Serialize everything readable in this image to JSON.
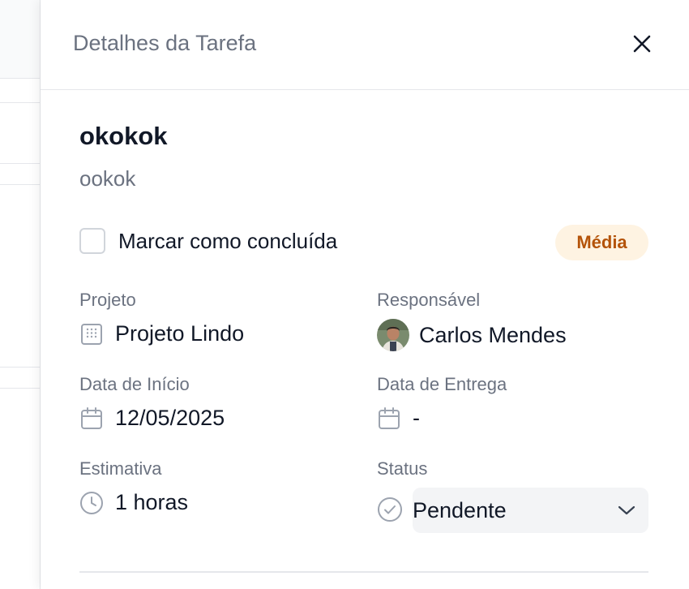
{
  "drawer": {
    "title": "Detalhes da Tarefa"
  },
  "task": {
    "title": "okokok",
    "description": "ookok",
    "complete_label": "Marcar como concluída",
    "priority": "Média"
  },
  "fields": {
    "project": {
      "label": "Projeto",
      "value": "Projeto Lindo",
      "icon": "building-icon"
    },
    "assignee": {
      "label": "Responsável",
      "value": "Carlos Mendes",
      "icon": "avatar"
    },
    "start_date": {
      "label": "Data de Início",
      "value": "12/05/2025",
      "icon": "calendar-icon"
    },
    "due_date": {
      "label": "Data de Entrega",
      "value": "-",
      "icon": "calendar-icon"
    },
    "estimate": {
      "label": "Estimativa",
      "value": "1 horas",
      "icon": "clock-icon"
    },
    "status": {
      "label": "Status",
      "value": "Pendente",
      "icon": "check-circle-icon"
    }
  },
  "colors": {
    "priority_bg": "#fef3e2",
    "priority_text": "#b45309",
    "muted": "#6b7280",
    "text": "#111827"
  }
}
